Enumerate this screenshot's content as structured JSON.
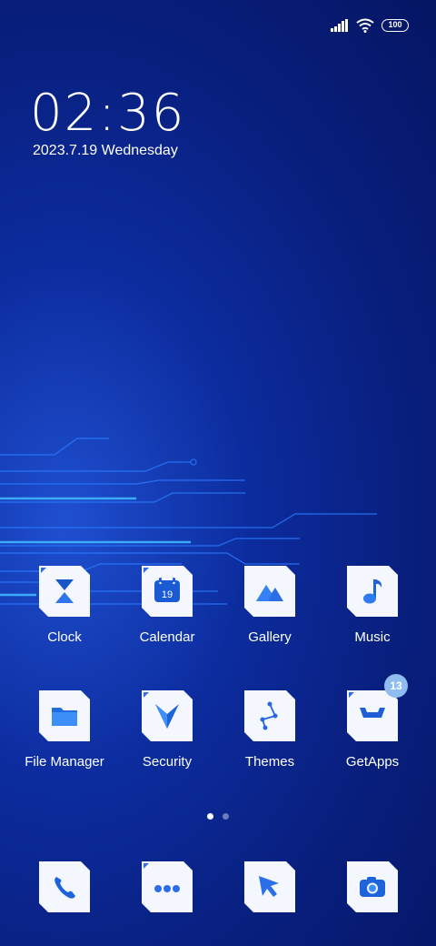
{
  "status_bar": {
    "battery_level": "100",
    "signal_icon": "signal-bars-icon",
    "wifi_icon": "wifi-icon"
  },
  "clock": {
    "time": "02:36",
    "date": "2023.7.19 Wednesday"
  },
  "apps_row1": [
    {
      "label": "Clock",
      "icon": "hourglass-icon"
    },
    {
      "label": "Calendar",
      "icon": "calendar-icon",
      "day": "19"
    },
    {
      "label": "Gallery",
      "icon": "mountain-icon"
    },
    {
      "label": "Music",
      "icon": "music-note-icon"
    }
  ],
  "apps_row2": [
    {
      "label": "File Manager",
      "icon": "folder-icon"
    },
    {
      "label": "Security",
      "icon": "shield-check-icon"
    },
    {
      "label": "Themes",
      "icon": "themes-icon"
    },
    {
      "label": "GetApps",
      "icon": "store-icon",
      "badge": "13"
    }
  ],
  "dock": [
    {
      "icon": "phone-icon"
    },
    {
      "icon": "messages-icon"
    },
    {
      "icon": "browser-cursor-icon"
    },
    {
      "icon": "camera-icon"
    }
  ],
  "pages": {
    "count": 2,
    "active": 1
  },
  "colors": {
    "accent": "#2f6fe0",
    "tile": "#f4f7fd",
    "background": "#0a2590"
  }
}
